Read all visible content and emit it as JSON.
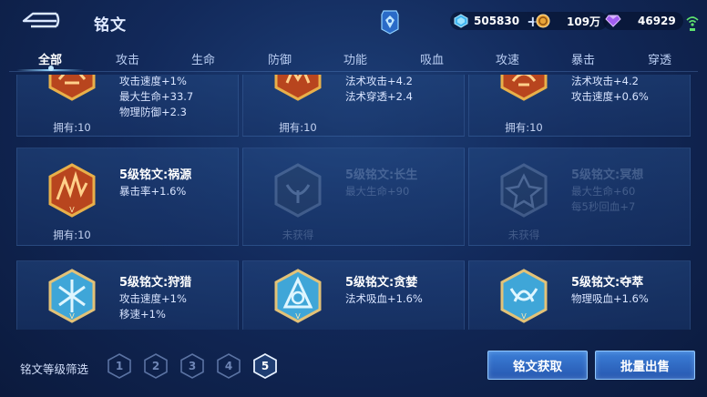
{
  "header": {
    "title": "铭文",
    "currencies": [
      {
        "name": "diamond",
        "value": "505830",
        "color": "#5fd1ff"
      },
      {
        "name": "gold",
        "value": "109万",
        "color": "#f2b24b"
      },
      {
        "name": "gem",
        "value": "46929",
        "color": "#b070ff"
      }
    ]
  },
  "tabs": [
    "全部",
    "攻击",
    "生命",
    "防御",
    "功能",
    "吸血",
    "攻速",
    "暴击",
    "穿透"
  ],
  "active_tab": "全部",
  "cards": [
    {
      "name": "",
      "stats": [
        "攻击速度+1%",
        "最大生命+33.7",
        "物理防御+2.3"
      ],
      "owned": "拥有:10",
      "color": "red"
    },
    {
      "name": "",
      "stats": [
        "法术攻击+4.2",
        "法术穿透+2.4"
      ],
      "owned": "拥有:10",
      "color": "red"
    },
    {
      "name": "",
      "stats": [
        "法术攻击+4.2",
        "攻击速度+0.6%"
      ],
      "owned": "拥有:10",
      "color": "red"
    },
    {
      "name": "5级铭文:祸源",
      "stats": [
        "暴击率+1.6%"
      ],
      "owned": "拥有:10",
      "color": "red"
    },
    {
      "name": "5级铭文:长生",
      "stats": [
        "最大生命+90"
      ],
      "owned": "未获得",
      "color": "gray"
    },
    {
      "name": "5级铭文:冥想",
      "stats": [
        "最大生命+60",
        "每5秒回血+7"
      ],
      "owned": "未获得",
      "color": "gray"
    },
    {
      "name": "5级铭文:狩猎",
      "stats": [
        "攻击速度+1%",
        "移速+1%"
      ],
      "owned": "",
      "color": "blue"
    },
    {
      "name": "5级铭文:贪婪",
      "stats": [
        "法术吸血+1.6%"
      ],
      "owned": "",
      "color": "blue"
    },
    {
      "name": "5级铭文:夺萃",
      "stats": [
        "物理吸血+1.6%"
      ],
      "owned": "",
      "color": "blue"
    }
  ],
  "filter": {
    "label": "铭文等级筛选",
    "levels": [
      "1",
      "2",
      "3",
      "4",
      "5"
    ],
    "selected": "5"
  },
  "buttons": {
    "obtain": "铭文获取",
    "bulk_sell": "批量出售"
  }
}
